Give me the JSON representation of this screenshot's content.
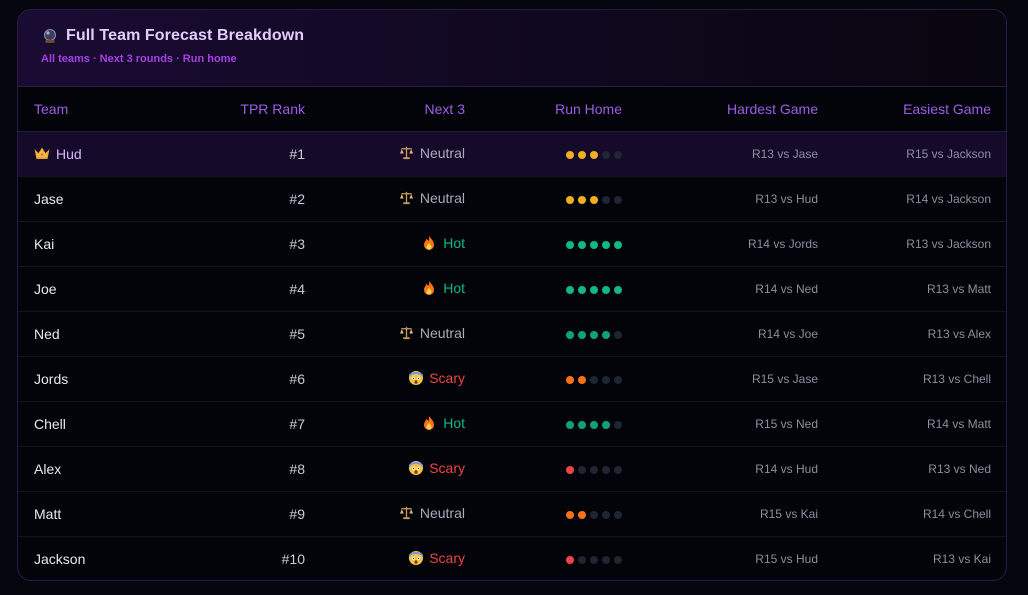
{
  "header": {
    "title": "Full Team Forecast Breakdown",
    "title_icon": "crystal-ball-icon",
    "subtitle": "All teams · Next 3 rounds · Run home"
  },
  "columns": [
    "Team",
    "TPR Rank",
    "Next 3",
    "Run Home",
    "Hardest Game",
    "Easiest Game"
  ],
  "colors": {
    "neutral": "#a7abb8",
    "hot": "#10b981",
    "scary": "#ef4444",
    "dot_empty": "#1e2533"
  },
  "rows": [
    {
      "team": "Hud",
      "crown": true,
      "rank": "#1",
      "status": "Neutral",
      "status_type": "neutral",
      "run_home": 3,
      "dot_color": "#f2b01e",
      "hardest": "R13 vs Jase",
      "easiest": "R15 vs Jackson"
    },
    {
      "team": "Jase",
      "crown": false,
      "rank": "#2",
      "status": "Neutral",
      "status_type": "neutral",
      "run_home": 3,
      "dot_color": "#f2b01e",
      "hardest": "R13 vs Hud",
      "easiest": "R14 vs Jackson"
    },
    {
      "team": "Kai",
      "crown": false,
      "rank": "#3",
      "status": "Hot",
      "status_type": "hot",
      "run_home": 5,
      "dot_color": "#10b981",
      "hardest": "R14 vs Jords",
      "easiest": "R13 vs Jackson"
    },
    {
      "team": "Joe",
      "crown": false,
      "rank": "#4",
      "status": "Hot",
      "status_type": "hot",
      "run_home": 5,
      "dot_color": "#10b981",
      "hardest": "R14 vs Ned",
      "easiest": "R13 vs Matt"
    },
    {
      "team": "Ned",
      "crown": false,
      "rank": "#5",
      "status": "Neutral",
      "status_type": "neutral",
      "run_home": 4,
      "dot_color": "#10a37a",
      "hardest": "R14 vs Joe",
      "easiest": "R13 vs Alex"
    },
    {
      "team": "Jords",
      "crown": false,
      "rank": "#6",
      "status": "Scary",
      "status_type": "scary",
      "run_home": 2,
      "dot_color": "#f97316",
      "hardest": "R15 vs Jase",
      "easiest": "R13 vs Chell"
    },
    {
      "team": "Chell",
      "crown": false,
      "rank": "#7",
      "status": "Hot",
      "status_type": "hot",
      "run_home": 4,
      "dot_color": "#10a37a",
      "hardest": "R15 vs Ned",
      "easiest": "R14 vs Matt"
    },
    {
      "team": "Alex",
      "crown": false,
      "rank": "#8",
      "status": "Scary",
      "status_type": "scary",
      "run_home": 1,
      "dot_color": "#ef4444",
      "hardest": "R14 vs Hud",
      "easiest": "R13 vs Ned"
    },
    {
      "team": "Matt",
      "crown": false,
      "rank": "#9",
      "status": "Neutral",
      "status_type": "neutral",
      "run_home": 2,
      "dot_color": "#f97316",
      "hardest": "R15 vs Kai",
      "easiest": "R14 vs Chell"
    },
    {
      "team": "Jackson",
      "crown": false,
      "rank": "#10",
      "status": "Scary",
      "status_type": "scary",
      "run_home": 1,
      "dot_color": "#ef4444",
      "hardest": "R15 vs Hud",
      "easiest": "R13 vs Kai"
    }
  ]
}
